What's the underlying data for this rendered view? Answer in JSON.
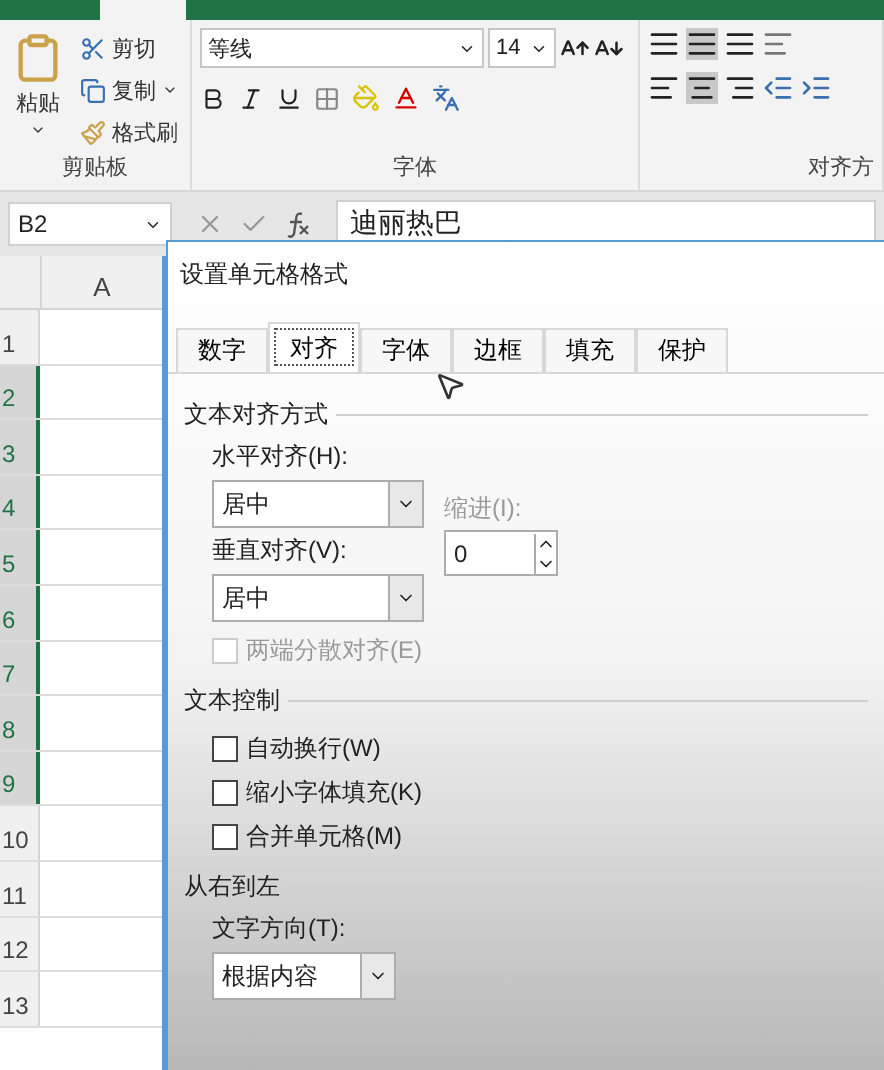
{
  "ribbon": {
    "clipboard": {
      "paste": "粘贴",
      "cut": "剪切",
      "copy": "复制",
      "format_painter": "格式刷",
      "label": "剪贴板"
    },
    "font": {
      "font_name": "等线",
      "font_size": "14",
      "label": "字体"
    },
    "alignment": {
      "label": "对齐方"
    }
  },
  "formula_bar": {
    "name_box": "B2",
    "content": "迪丽热巴"
  },
  "sheet": {
    "columns": [
      "A"
    ],
    "rows": [
      {
        "label": "1",
        "selected": false
      },
      {
        "label": "2",
        "selected": true
      },
      {
        "label": "3",
        "selected": true
      },
      {
        "label": "4",
        "selected": true
      },
      {
        "label": "5",
        "selected": true
      },
      {
        "label": "6",
        "selected": true
      },
      {
        "label": "7",
        "selected": true
      },
      {
        "label": "8",
        "selected": true
      },
      {
        "label": "9",
        "selected": true
      },
      {
        "label": "10",
        "selected": false
      },
      {
        "label": "11",
        "selected": false
      },
      {
        "label": "12",
        "selected": false
      },
      {
        "label": "13",
        "selected": false
      }
    ]
  },
  "dialog": {
    "title": "设置单元格格式",
    "tabs": [
      {
        "label": "数字",
        "selected": false
      },
      {
        "label": "对齐",
        "selected": true
      },
      {
        "label": "字体",
        "selected": false
      },
      {
        "label": "边框",
        "selected": false
      },
      {
        "label": "填充",
        "selected": false
      },
      {
        "label": "保护",
        "selected": false
      }
    ],
    "text_alignment": {
      "heading": "文本对齐方式",
      "horizontal_label": "水平对齐(H):",
      "horizontal_value": "居中",
      "indent_label": "缩进(I):",
      "indent_value": "0",
      "vertical_label": "垂直对齐(V):",
      "vertical_value": "居中",
      "distributed": {
        "label": "两端分散对齐(E)",
        "checked": false,
        "disabled": true
      }
    },
    "text_control": {
      "heading": "文本控制",
      "options": [
        {
          "label": "自动换行(W)",
          "checked": false,
          "disabled": false
        },
        {
          "label": "缩小字体填充(K)",
          "checked": false,
          "disabled": false
        },
        {
          "label": "合并单元格(M)",
          "checked": false,
          "disabled": false
        }
      ]
    },
    "right_to_left": {
      "heading": "从右到左",
      "direction_label": "文字方向(T):",
      "direction_value": "根据内容"
    }
  }
}
